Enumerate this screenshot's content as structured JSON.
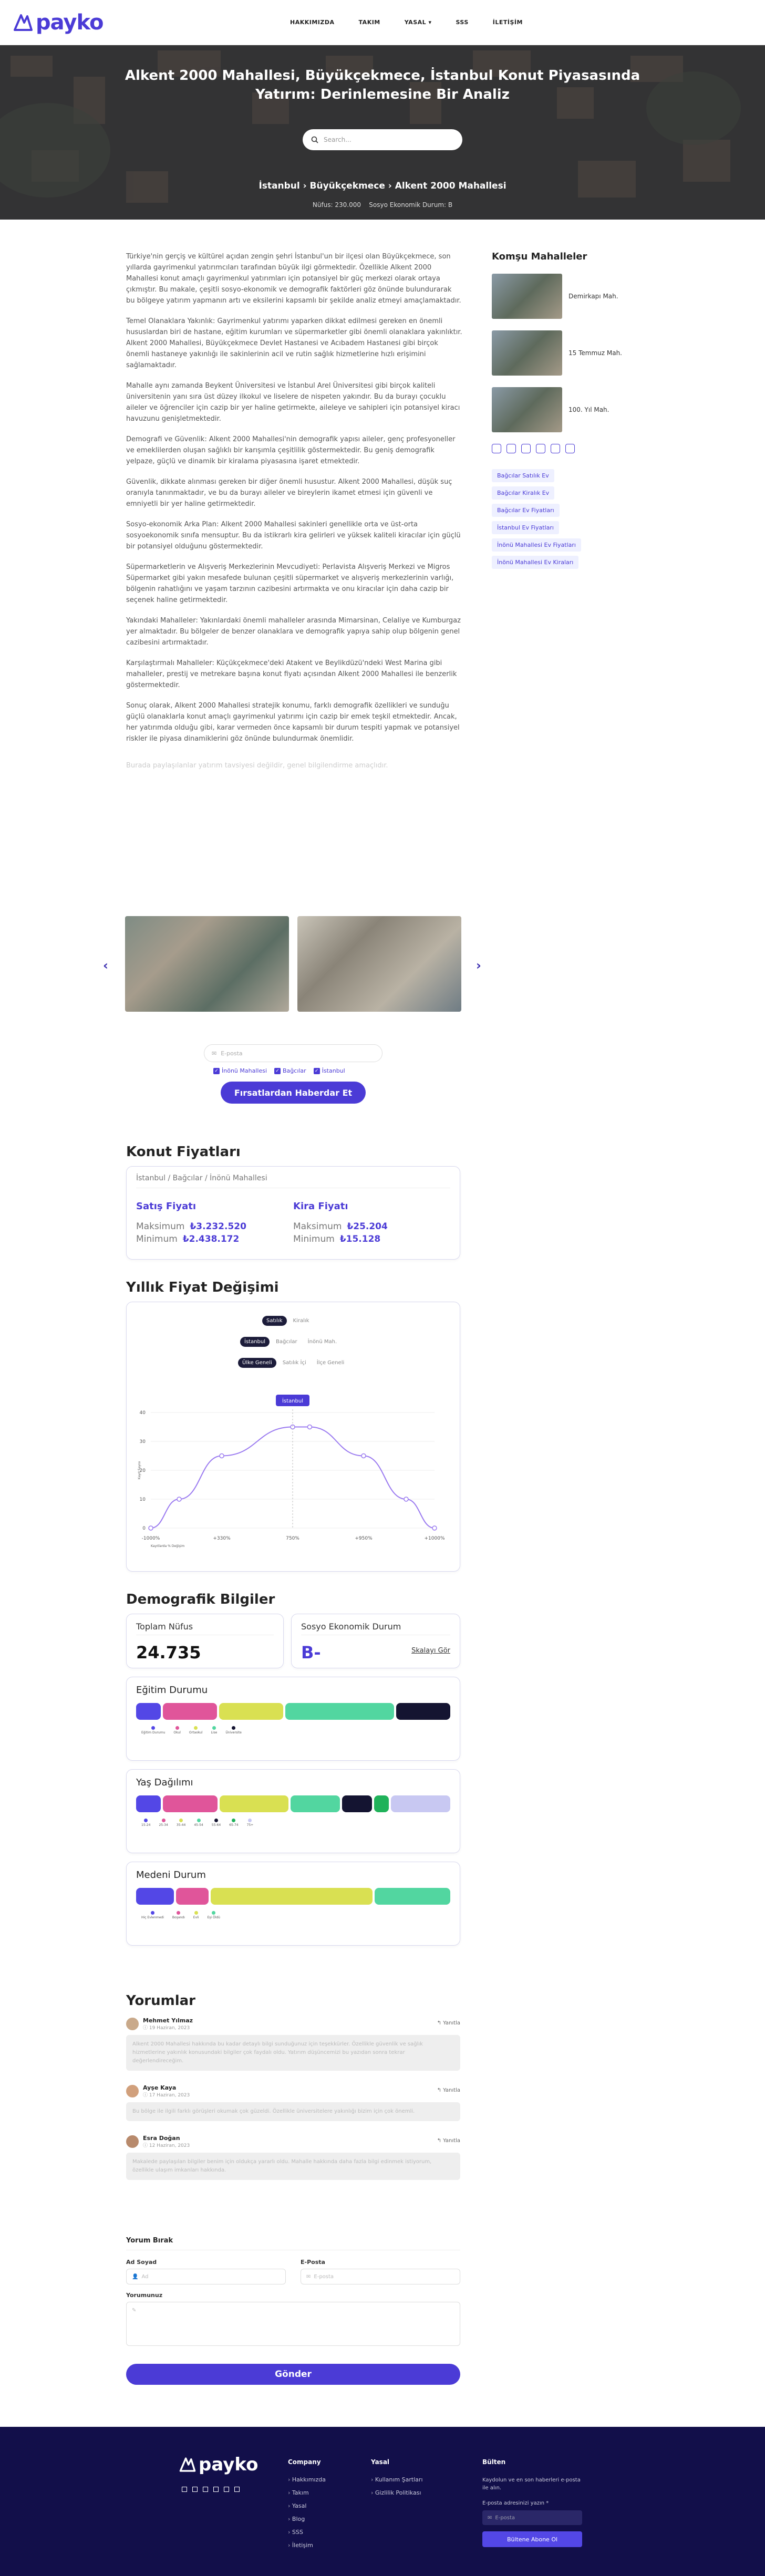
{
  "header": {
    "brand": "payko",
    "nav": [
      "HAKKIMIZDA",
      "TAKIM",
      "YASAL ▾",
      "SSS",
      "İLETİŞİM"
    ]
  },
  "hero": {
    "title": "Alkent 2000 Mahallesi, Büyükçekmece, İstanbul Konut Piyasasında Yatırım: Derinlemesine Bir Analiz",
    "search_placeholder": "Search...",
    "breadcrumb": "İstanbul › Büyükçekmece › Alkent 2000 Mahallesi",
    "meta_population_label": "Nüfus:",
    "meta_population": "230.000",
    "meta_socio_label": "Sosyo Ekonomik Durum:",
    "meta_socio": "B"
  },
  "article": {
    "p1": "Türkiye'nin gerçiş ve kültürel açıdan zengin şehri İstanbul'un bir ilçesi olan Büyükçekmece, son yıllarda gayrimenkul yatırımcıları tarafından büyük ilgi görmektedir. Özellikle Alkent 2000 Mahallesi konut amaçlı gayrimenkul yatırımları için potansiyel bir güç merkezi olarak ortaya çıkmıştır. Bu makale, çeşitli sosyo-ekonomik ve demografik faktörleri göz önünde bulundurarak bu bölgeye yatırım yapmanın artı ve eksilerini kapsamlı bir şekilde analiz etmeyi amaçlamaktadır.",
    "p2": "Temel Olanaklara Yakınlık: Gayrimenkul yatırımı yaparken dikkat edilmesi gereken en önemli hususlardan biri de hastane, eğitim kurumları ve süpermarketler gibi önemli olanaklara yakınlıktır. Alkent 2000 Mahallesi, Büyükçekmece Devlet Hastanesi ve Acıbadem Hastanesi gibi birçok önemli hastaneye yakınlığı ile sakinlerinin acil ve rutin sağlık hizmetlerine hızlı erişimini sağlamaktadır.",
    "p3": "Mahalle aynı zamanda Beykent Üniversitesi ve İstanbul Arel Üniversitesi gibi birçok kaliteli üniversitenin yanı sıra üst düzey ilkokul ve liselere de nispeten yakındır. Bu da burayı çocuklu aileler ve öğrenciler için cazip bir yer haline getirmekte, aileleye ve sahipleri için potansiyel kiracı havuzunu genişletmektedir.",
    "p4": "Demografi ve Güvenlik: Alkent 2000 Mahallesi'nin demografik yapısı aileler, genç profesyoneller ve emeklilerden oluşan sağlıklı bir karışımla çeşitlilik göstermektedir. Bu geniş demografik yelpaze, güçlü ve dinamik bir kiralama piyasasına işaret etmektedir.",
    "p5": "Güvenlik, dikkate alınması gereken bir diğer önemli husustur. Alkent 2000 Mahallesi, düşük suç oranıyla tanınmaktadır, ve bu da burayı aileler ve bireylerin ikamet etmesi için güvenli ve emniyetli bir yer haline getirmektedir.",
    "p6": "Sosyo-ekonomik Arka Plan: Alkent 2000 Mahallesi sakinleri genellikle orta ve üst-orta sosyoekonomik sınıfa mensuptur. Bu da istikrarlı kira gelirleri ve yüksek kaliteli kiracılar için güçlü bir potansiyel olduğunu göstermektedir.",
    "p7": "Süpermarketlerin ve Alışveriş Merkezlerinin Mevcudiyeti: Perlavista Alışveriş Merkezi ve Migros Süpermarket gibi yakın mesafede bulunan çeşitli süpermarket ve alışveriş merkezlerinin varlığı, bölgenin rahatlığını ve yaşam tarzının cazibesini artırmakta ve onu kiracılar için daha cazip bir seçenek haline getirmektedir.",
    "p8": "Yakındaki Mahalleler: Yakınlardaki önemli mahalleler arasında Mimarsinan, Celaliye ve Kumburgaz yer almaktadır. Bu bölgeler de benzer olanaklara ve demografik yapıya sahip olup bölgenin genel cazibesini artırmaktadır.",
    "p9": "Karşılaştırmalı Mahalleler: Küçükçekmece'deki Atakent ve Beylikdüzü'ndeki West Marina gibi mahalleler, prestij ve metrekare başına konut fiyatı açısından Alkent 2000 Mahallesi ile benzerlik göstermektedir.",
    "p10": "Sonuç olarak, Alkent 2000 Mahallesi stratejik konumu, farklı demografik özellikleri ve sunduğu güçlü olanaklarla konut amaçlı gayrimenkul yatırımı için cazip bir emek teşkil etmektedir. Ancak, her yatırımda olduğu gibi, karar vermeden önce kapsamlı bir durum tespiti yapmak ve potansiyel riskler ile piyasa dinamiklerini göz önünde bulundurmak önemlidir.",
    "disclaimer": "Burada paylaşılanlar yatırım tavsiyesi değildir, genel bilgilendirme amaçlıdır."
  },
  "sidebar": {
    "title": "Komşu Mahalleler",
    "neighbors": [
      "Demirkapı Mah.",
      "15 Temmuz Mah.",
      "100. Yıl Mah."
    ],
    "social_icons": [
      "instagram-icon",
      "instagram-icon",
      "twitter-icon",
      "youtube-icon",
      "linkedin-icon",
      "youtube-icon"
    ],
    "tags": [
      "Bağcılar Satılık Ev",
      "Bağcılar Kiralık Ev",
      "Bağcılar Ev Fiyatları",
      "İstanbul Ev Fiyatları",
      "İnönü Mahallesi Ev Fiyatları",
      "İnönü Mahallesi Ev Kiraları"
    ]
  },
  "alert": {
    "email_placeholder": "E-posta",
    "checks": [
      "İnönü Mahallesi",
      "Bağcılar",
      "İstanbul"
    ],
    "button": "Fırsatlardan Haberdar Et"
  },
  "prices": {
    "title": "Konut Fiyatları",
    "location": "İstanbul / Bağcılar / İnönü Mahallesi",
    "sale_title": "Satış Fiyatı",
    "rent_title": "Kira Fiyatı",
    "max_label": "Maksimum",
    "min_label": "Minimum",
    "sale_max": "₺3.232.520",
    "sale_min": "₺2.438.172",
    "rent_max": "₺25.204",
    "rent_min": "₺15.128"
  },
  "yearly": {
    "title": "Yıllık Fiyat Değişimi",
    "toggle1": [
      "Satılık",
      "Kiralık"
    ],
    "toggle2": [
      "İstanbul",
      "Bağcılar",
      "İnönü Mah."
    ],
    "toggle3": [
      "Ülke Geneli",
      "Satılık İçi",
      "İlçe Geneli"
    ]
  },
  "chart_data": {
    "type": "line",
    "x": [
      "-1000%",
      "+330%",
      "750%",
      "+950%",
      "+1000%"
    ],
    "yticks": [
      0,
      10,
      20,
      30,
      40
    ],
    "ylim": [
      0,
      40
    ],
    "ylabel": "Kayıt Sayısı",
    "xlabel": "Kayıtlarda % Değişim",
    "series": [
      {
        "name": "İstanbul",
        "values": [
          0,
          25,
          35,
          25,
          0
        ]
      }
    ],
    "extra_points": [
      {
        "x_frac": 0.1,
        "y": 10
      },
      {
        "x_frac": 0.25,
        "y": 25
      },
      {
        "x_frac": 0.5,
        "y": 35
      },
      {
        "x_frac": 0.56,
        "y": 35
      },
      {
        "x_frac": 0.75,
        "y": 25
      },
      {
        "x_frac": 0.9,
        "y": 10
      }
    ],
    "highlight_label": "İstanbul",
    "accent": "#9b7bf0"
  },
  "demographics": {
    "title": "Demografik Bilgiler",
    "pop_label": "Toplam Nüfus",
    "pop_value": "24.735",
    "socio_label": "Sosyo Ekonomik Durum",
    "socio_value": "B-",
    "socio_link": "Skalayı Gör",
    "education": {
      "title": "Eğitim Durumu",
      "parts": [
        {
          "c": "#5347e6",
          "w": 5
        },
        {
          "c": "#e0559a",
          "w": 11
        },
        {
          "c": "#d9e052",
          "w": 13
        },
        {
          "c": "#52d6a0",
          "w": 22
        },
        {
          "c": "#141431",
          "w": 11
        }
      ],
      "legend": [
        "Eğitim Durumu",
        "Okul",
        "Ortaokul",
        "Lise",
        "Üniversite"
      ]
    },
    "age": {
      "title": "Yaş Dağılımı",
      "parts": [
        {
          "c": "#5347e6",
          "w": 5
        },
        {
          "c": "#e0559a",
          "w": 11
        },
        {
          "c": "#d9e052",
          "w": 14
        },
        {
          "c": "#52d6a0",
          "w": 10
        },
        {
          "c": "#141431",
          "w": 6
        },
        {
          "c": "#20b25a",
          "w": 3
        },
        {
          "c": "#c8c8f2",
          "w": 12
        }
      ],
      "legend": [
        "15-24",
        "25-34",
        "35-44",
        "45-54",
        "55-64",
        "65-74",
        "75+"
      ]
    },
    "marital": {
      "title": "Medeni Durum",
      "parts": [
        {
          "c": "#5347e6",
          "w": 7
        },
        {
          "c": "#e0559a",
          "w": 6
        },
        {
          "c": "#d9e052",
          "w": 30
        },
        {
          "c": "#52d6a0",
          "w": 14
        }
      ],
      "legend": [
        "Hiç Evlenmedi",
        "Boşandı",
        "Evli",
        "Eşi Öldü"
      ]
    }
  },
  "comments": {
    "title": "Yorumlar",
    "reply": "↰ Yanıtla",
    "items": [
      {
        "name": "Mehmet Yılmaz",
        "date": "ⓘ 19 Haziran, 2023",
        "text": "Alkent 2000 Mahallesi hakkında bu kadar detaylı bilgi sunduğunuz için teşekkürler. Özellikle güvenlik ve sağlık hizmetlerine yakınlık konusundaki bilgiler çok faydalı oldu. Yatırım düşüncemizi bu yazıdan sonra tekrar değerlendireceğim."
      },
      {
        "name": "Ayşe Kaya",
        "date": "ⓘ 17 Haziran, 2023",
        "text": "Bu bölge ile ilgili farklı görüşleri okumak çok güzeldi. Özellikle üniversitelere yakınlığı bizim için çok önemli."
      },
      {
        "name": "Esra Doğan",
        "date": "ⓘ 12 Haziran, 2023",
        "text": "Makalede paylaşılan bilgiler benim için oldukça yararlı oldu. Mahalle hakkında daha fazla bilgi edinmek istiyorum, özellikle ulaşım imkanları hakkında."
      }
    ]
  },
  "form": {
    "title": "Yorum Bırak",
    "name_label": "Ad Soyad",
    "name_ph": "Ad",
    "email_label": "E-Posta",
    "email_ph": "E-posta",
    "comment_label": "Yorumunuz",
    "submit": "Gönder"
  },
  "footer": {
    "brand": "payko",
    "company_title": "Company",
    "company": [
      "Hakkımızda",
      "Takım",
      "Yasal",
      "Blog",
      "SSS",
      "İletişim"
    ],
    "legal_title": "Yasal",
    "legal": [
      "Kullanım Şartları",
      "Gizlilik Politikası"
    ],
    "bulten_title": "Bülten",
    "bulten_text": "Kaydolun ve en son haberleri e-posta ile alın.",
    "bulten_label": "E-posta adresinizi yazın *",
    "bulten_ph": "E-posta",
    "bulten_btn": "Bültene Abone Ol"
  }
}
